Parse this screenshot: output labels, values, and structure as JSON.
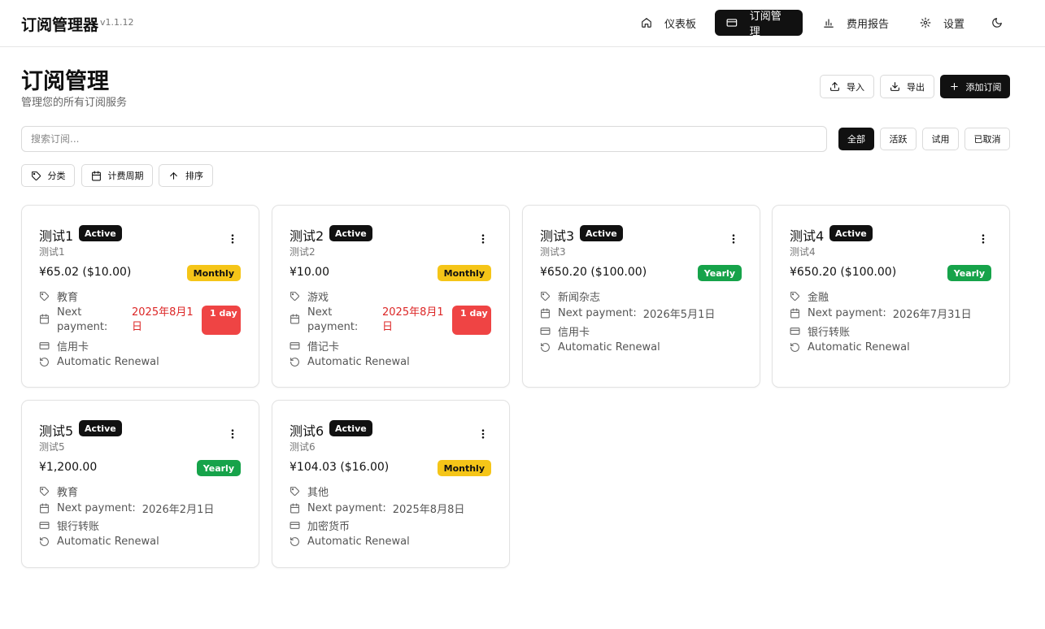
{
  "app": {
    "title": "订阅管理器",
    "version": "v1.1.12"
  },
  "nav": {
    "dashboard": "仪表板",
    "subscriptions": "订阅管理",
    "reports": "费用报告",
    "settings": "设置"
  },
  "page": {
    "title": "订阅管理",
    "subtitle": "管理您的所有订阅服务"
  },
  "actions": {
    "import": "导入",
    "export": "导出",
    "add": "添加订阅"
  },
  "search": {
    "placeholder": "搜索订阅...",
    "value": ""
  },
  "status_filters": {
    "all": "全部",
    "active": "活跃",
    "trial": "试用",
    "cancelled": "已取消",
    "selected": "全部"
  },
  "filters": {
    "category": "分类",
    "billing_cycle": "计费周期",
    "sort": "排序"
  },
  "subscriptions": [
    {
      "name": "测试1",
      "status": "Active",
      "description": "测试1",
      "price": "¥65.02 ($10.00)",
      "cycle": "Monthly",
      "category": "教育",
      "next_label": "Next payment:",
      "next_date": "2025年8月1日",
      "days_left": "1 day",
      "payment_method": "信用卡",
      "renewal": "Automatic Renewal"
    },
    {
      "name": "测试2",
      "status": "Active",
      "description": "测试2",
      "price": "¥10.00",
      "cycle": "Monthly",
      "category": "游戏",
      "next_label": "Next payment:",
      "next_date": "2025年8月1日",
      "days_left": "1 day",
      "payment_method": "借记卡",
      "renewal": "Automatic Renewal"
    },
    {
      "name": "测试3",
      "status": "Active",
      "description": "测试3",
      "price": "¥650.20 ($100.00)",
      "cycle": "Yearly",
      "category": "新闻杂志",
      "next_label": "Next payment:",
      "next_date": "2026年5月1日",
      "payment_method": "信用卡",
      "renewal": "Automatic Renewal"
    },
    {
      "name": "测试4",
      "status": "Active",
      "description": "测试4",
      "price": "¥650.20 ($100.00)",
      "cycle": "Yearly",
      "category": "金融",
      "next_label": "Next payment:",
      "next_date": "2026年7月31日",
      "payment_method": "银行转账",
      "renewal": "Automatic Renewal"
    },
    {
      "name": "测试5",
      "status": "Active",
      "description": "测试5",
      "price": "¥1,200.00",
      "cycle": "Yearly",
      "category": "教育",
      "next_label": "Next payment:",
      "next_date": "2026年2月1日",
      "payment_method": "银行转账",
      "renewal": "Automatic Renewal"
    },
    {
      "name": "测试6",
      "status": "Active",
      "description": "测试6",
      "price": "¥104.03 ($16.00)",
      "cycle": "Monthly",
      "category": "其他",
      "next_label": "Next payment:",
      "next_date": "2025年8月8日",
      "payment_method": "加密货币",
      "renewal": "Automatic Renewal"
    }
  ],
  "colors": {
    "primary": "#111111",
    "monthly": "#f5c518",
    "yearly": "#16a34a",
    "due_soon": "#ef4444",
    "due_text": "#dc2626"
  },
  "icons": [
    "home-icon",
    "card-icon",
    "bar-chart-icon",
    "gear-icon",
    "moon-icon",
    "upload-icon",
    "download-icon",
    "plus-icon",
    "tag-icon",
    "calendar-icon",
    "arrow-up-icon",
    "more-vertical-icon",
    "refresh-icon"
  ]
}
